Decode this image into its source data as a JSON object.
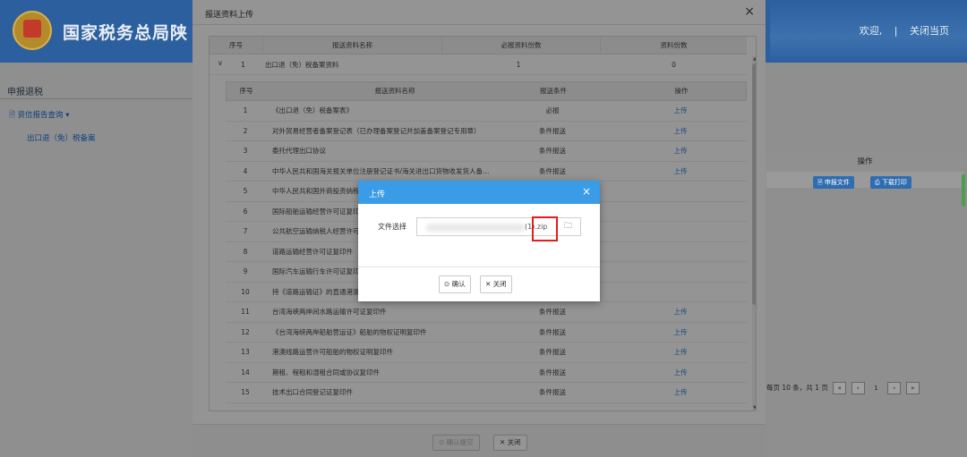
{
  "app": {
    "brand": "国家税务总局陕",
    "welcome": "欢迎,",
    "separator": "|",
    "close_page": "关闭当页",
    "left_title": "申报退税",
    "left_menu": "资信报告查询 ▾",
    "left_sub": "出口退（免）税备案",
    "right_header": "操作",
    "right_btn1": "申报文件",
    "right_btn2": "下载打印",
    "pager_text": "每页 10 条，共 1 页",
    "pager_buttons": [
      "«",
      "‹",
      "1",
      "›",
      "»"
    ]
  },
  "modal": {
    "title": "报送资料上传",
    "close_icon": "×",
    "outer_headers": [
      "序号",
      "报送资料名称",
      "必报资料份数",
      "资料份数"
    ],
    "outer_row": {
      "expand": "∨",
      "no": "1",
      "name": "出口退（免）税备案资料",
      "required": "1",
      "count": "0"
    },
    "inner_headers": [
      "序号",
      "报送资料名称",
      "报送条件",
      "操作"
    ],
    "rows": [
      {
        "no": "1",
        "name": "《出口退（免）税备案表》",
        "cond": "必报",
        "op": "上传"
      },
      {
        "no": "2",
        "name": "对外贸易经营者备案登记表（已办理备案登记并加盖备案登记专用章）",
        "cond": "条件报送",
        "op": "上传"
      },
      {
        "no": "3",
        "name": "委托代理出口协议",
        "cond": "条件报送",
        "op": "上传"
      },
      {
        "no": "4",
        "name": "中华人民共和国海关报关单位注册登记证书/海关进出口货物收发货人备…",
        "cond": "条件报送",
        "op": "上传"
      },
      {
        "no": "5",
        "name": "中华人民共和国外商投资纳税人批",
        "cond": "",
        "op": ""
      },
      {
        "no": "6",
        "name": "国际船舶运输经营许可证复印件",
        "cond": "",
        "op": ""
      },
      {
        "no": "7",
        "name": "公共航空运输纳税人经营许可证复",
        "cond": "",
        "op": ""
      },
      {
        "no": "8",
        "name": "道路运输经营许可证复印件",
        "cond": "",
        "op": ""
      },
      {
        "no": "9",
        "name": "国际汽车运输行车许可证复印件",
        "cond": "",
        "op": ""
      },
      {
        "no": "10",
        "name": "持《道路运输证》的直通港澳运输",
        "cond": "",
        "op": ""
      },
      {
        "no": "11",
        "name": "台湾海峡两岸间水路运输许可证复印件",
        "cond": "条件报送",
        "op": "上传"
      },
      {
        "no": "12",
        "name": "《台湾海峡两岸船舶营运证》船舶的物权证明复印件",
        "cond": "条件报送",
        "op": "上传"
      },
      {
        "no": "13",
        "name": "港澳线路运营许可船舶的物权证明复印件",
        "cond": "条件报送",
        "op": "上传"
      },
      {
        "no": "14",
        "name": "期租、程租和湿租合同或协议复印件",
        "cond": "条件报送",
        "op": "上传"
      },
      {
        "no": "15",
        "name": "技术出口合同登记证复印件",
        "cond": "条件报送",
        "op": "上传"
      }
    ],
    "confirm_submit": "确认提交",
    "close": "关闭"
  },
  "upload": {
    "title": "上传",
    "close_icon": "×",
    "label": "文件选择",
    "filename": "(1).zip",
    "folder_icon": "🗀",
    "confirm": "确认",
    "close": "关闭"
  }
}
